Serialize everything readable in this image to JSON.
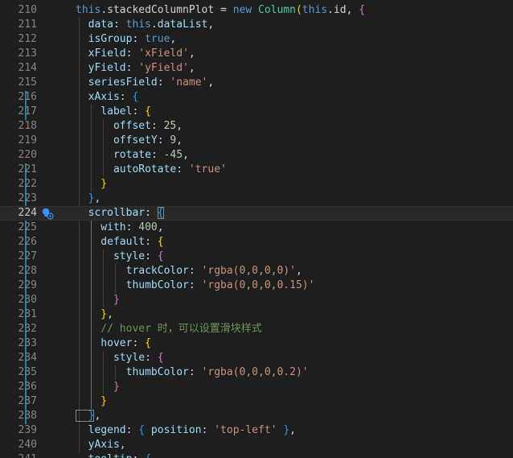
{
  "editor": {
    "theme": {
      "background": "#1e1e1e",
      "accent": "#1b81a8"
    },
    "lines": [
      {
        "num": "210",
        "tokens": [
          {
            "t": "this",
            "c": "kw"
          },
          {
            "t": ".stackedColumnPlot = ",
            "c": "punct"
          },
          {
            "t": "new ",
            "c": "kw"
          },
          {
            "t": "Column",
            "c": "cls"
          },
          {
            "t": "(",
            "c": "br1"
          },
          {
            "t": "this",
            "c": "kw"
          },
          {
            "t": ".id, ",
            "c": "punct"
          },
          {
            "t": "{",
            "c": "br2"
          }
        ]
      },
      {
        "num": "211",
        "tokens": [
          {
            "t": "  data",
            "c": "prop"
          },
          {
            "t": ": ",
            "c": "punct"
          },
          {
            "t": "this",
            "c": "kw"
          },
          {
            "t": ".",
            "c": "punct"
          },
          {
            "t": "dataList",
            "c": "prop"
          },
          {
            "t": ",",
            "c": "punct"
          }
        ]
      },
      {
        "num": "212",
        "tokens": [
          {
            "t": "  isGroup",
            "c": "prop"
          },
          {
            "t": ": ",
            "c": "punct"
          },
          {
            "t": "true",
            "c": "kw"
          },
          {
            "t": ",",
            "c": "punct"
          }
        ]
      },
      {
        "num": "213",
        "tokens": [
          {
            "t": "  xField",
            "c": "prop"
          },
          {
            "t": ": ",
            "c": "punct"
          },
          {
            "t": "'xField'",
            "c": "str"
          },
          {
            "t": ",",
            "c": "punct"
          }
        ]
      },
      {
        "num": "214",
        "tokens": [
          {
            "t": "  yField",
            "c": "prop"
          },
          {
            "t": ": ",
            "c": "punct"
          },
          {
            "t": "'yField'",
            "c": "str"
          },
          {
            "t": ",",
            "c": "punct"
          }
        ]
      },
      {
        "num": "215",
        "tokens": [
          {
            "t": "  seriesField",
            "c": "prop"
          },
          {
            "t": ": ",
            "c": "punct"
          },
          {
            "t": "'name'",
            "c": "str"
          },
          {
            "t": ",",
            "c": "punct"
          }
        ]
      },
      {
        "num": "216",
        "tokens": [
          {
            "t": "  xAxis",
            "c": "prop"
          },
          {
            "t": ": ",
            "c": "punct"
          },
          {
            "t": "{",
            "c": "br3"
          }
        ]
      },
      {
        "num": "217",
        "tokens": [
          {
            "t": "    label",
            "c": "prop"
          },
          {
            "t": ": ",
            "c": "punct"
          },
          {
            "t": "{",
            "c": "br1"
          }
        ]
      },
      {
        "num": "218",
        "tokens": [
          {
            "t": "      offset",
            "c": "prop"
          },
          {
            "t": ": ",
            "c": "punct"
          },
          {
            "t": "25",
            "c": "num"
          },
          {
            "t": ",",
            "c": "punct"
          }
        ]
      },
      {
        "num": "219",
        "tokens": [
          {
            "t": "      offsetY",
            "c": "prop"
          },
          {
            "t": ": ",
            "c": "punct"
          },
          {
            "t": "9",
            "c": "num"
          },
          {
            "t": ",",
            "c": "punct"
          }
        ]
      },
      {
        "num": "220",
        "tokens": [
          {
            "t": "      rotate",
            "c": "prop"
          },
          {
            "t": ": ",
            "c": "punct"
          },
          {
            "t": "-45",
            "c": "num"
          },
          {
            "t": ",",
            "c": "punct"
          }
        ]
      },
      {
        "num": "221",
        "tokens": [
          {
            "t": "      autoRotate",
            "c": "prop"
          },
          {
            "t": ": ",
            "c": "punct"
          },
          {
            "t": "'true'",
            "c": "str"
          }
        ]
      },
      {
        "num": "222",
        "tokens": [
          {
            "t": "    }",
            "c": "br1"
          }
        ]
      },
      {
        "num": "223",
        "tokens": [
          {
            "t": "  }",
            "c": "br3"
          },
          {
            "t": ",",
            "c": "punct"
          }
        ]
      },
      {
        "num": "224",
        "active": true,
        "tokens": [
          {
            "t": "  scrollbar",
            "c": "prop"
          },
          {
            "t": ": ",
            "c": "punct"
          },
          {
            "t": "{",
            "c": "br3",
            "match": true
          }
        ]
      },
      {
        "num": "225",
        "tokens": [
          {
            "t": "    with",
            "c": "prop"
          },
          {
            "t": ": ",
            "c": "punct"
          },
          {
            "t": "400",
            "c": "num"
          },
          {
            "t": ",",
            "c": "punct"
          }
        ]
      },
      {
        "num": "226",
        "tokens": [
          {
            "t": "    default",
            "c": "prop"
          },
          {
            "t": ": ",
            "c": "punct"
          },
          {
            "t": "{",
            "c": "br1"
          }
        ]
      },
      {
        "num": "227",
        "tokens": [
          {
            "t": "      style",
            "c": "prop"
          },
          {
            "t": ": ",
            "c": "punct"
          },
          {
            "t": "{",
            "c": "br2"
          }
        ]
      },
      {
        "num": "228",
        "tokens": [
          {
            "t": "        trackColor",
            "c": "prop"
          },
          {
            "t": ": ",
            "c": "punct"
          },
          {
            "t": "'rgba(0,0,0,0)'",
            "c": "str"
          },
          {
            "t": ",",
            "c": "punct"
          }
        ]
      },
      {
        "num": "229",
        "tokens": [
          {
            "t": "        thumbColor",
            "c": "prop"
          },
          {
            "t": ": ",
            "c": "punct"
          },
          {
            "t": "'rgba(0,0,0,0.15)'",
            "c": "str"
          }
        ]
      },
      {
        "num": "230",
        "tokens": [
          {
            "t": "      }",
            "c": "br2"
          }
        ]
      },
      {
        "num": "231",
        "tokens": [
          {
            "t": "    }",
            "c": "br1"
          },
          {
            "t": ",",
            "c": "punct"
          }
        ]
      },
      {
        "num": "232",
        "tokens": [
          {
            "t": "    // hover 时，可以设置滑块样式",
            "c": "cmt"
          }
        ]
      },
      {
        "num": "233",
        "tokens": [
          {
            "t": "    hover",
            "c": "prop"
          },
          {
            "t": ": ",
            "c": "punct"
          },
          {
            "t": "{",
            "c": "br1"
          }
        ]
      },
      {
        "num": "234",
        "tokens": [
          {
            "t": "      style",
            "c": "prop"
          },
          {
            "t": ": ",
            "c": "punct"
          },
          {
            "t": "{",
            "c": "br2"
          }
        ]
      },
      {
        "num": "235",
        "tokens": [
          {
            "t": "        thumbColor",
            "c": "prop"
          },
          {
            "t": ": ",
            "c": "punct"
          },
          {
            "t": "'rgba(0,0,0,0.2)'",
            "c": "str"
          }
        ]
      },
      {
        "num": "236",
        "tokens": [
          {
            "t": "      }",
            "c": "br2"
          }
        ]
      },
      {
        "num": "237",
        "tokens": [
          {
            "t": "    }",
            "c": "br1"
          }
        ]
      },
      {
        "num": "238",
        "tokens": [
          {
            "t": "  }",
            "c": "br3",
            "match": true
          },
          {
            "t": ",",
            "c": "punct"
          }
        ]
      },
      {
        "num": "239",
        "tokens": [
          {
            "t": "  legend",
            "c": "prop"
          },
          {
            "t": ": ",
            "c": "punct"
          },
          {
            "t": "{",
            "c": "br3"
          },
          {
            "t": " position",
            "c": "prop"
          },
          {
            "t": ": ",
            "c": "punct"
          },
          {
            "t": "'top-left'",
            "c": "str"
          },
          {
            "t": " ",
            "c": "punct"
          },
          {
            "t": "}",
            "c": "br3"
          },
          {
            "t": ",",
            "c": "punct"
          }
        ]
      },
      {
        "num": "240",
        "tokens": [
          {
            "t": "  yAxis",
            "c": "prop"
          },
          {
            "t": ",",
            "c": "punct"
          }
        ]
      },
      {
        "num": "241",
        "tokens": [
          {
            "t": "  tooltip",
            "c": "prop"
          },
          {
            "t": ": ",
            "c": "punct"
          },
          {
            "t": "{",
            "c": "br3"
          }
        ]
      }
    ]
  }
}
